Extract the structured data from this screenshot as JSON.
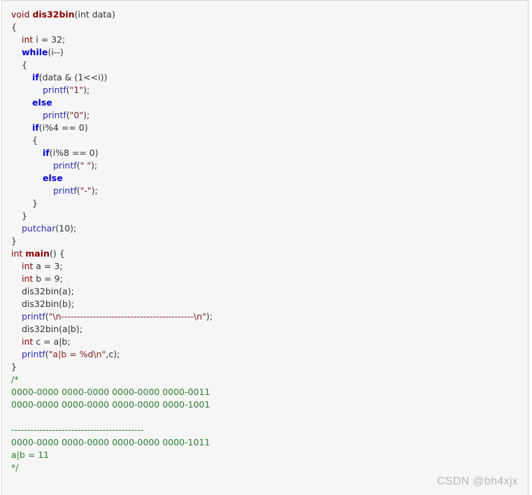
{
  "code": {
    "lines": [
      {
        "indent": 0,
        "parts": [
          {
            "t": "void ",
            "c": "kw-type"
          },
          {
            "t": "dis32bin",
            "c": "fn-def"
          },
          {
            "t": "(int data)",
            "c": ""
          }
        ]
      },
      {
        "indent": 0,
        "parts": [
          {
            "t": "{",
            "c": ""
          }
        ]
      },
      {
        "indent": 1,
        "parts": [
          {
            "t": "int",
            "c": "kw-type"
          },
          {
            "t": " i = 32;",
            "c": ""
          }
        ]
      },
      {
        "indent": 1,
        "parts": [
          {
            "t": "while",
            "c": "kw-ctrl"
          },
          {
            "t": "(i--)",
            "c": ""
          }
        ]
      },
      {
        "indent": 1,
        "parts": [
          {
            "t": "{",
            "c": ""
          }
        ]
      },
      {
        "indent": 2,
        "parts": [
          {
            "t": "if",
            "c": "kw-ctrl"
          },
          {
            "t": "(data & (1<<i))",
            "c": ""
          }
        ]
      },
      {
        "indent": 3,
        "parts": [
          {
            "t": "printf",
            "c": "fn-call"
          },
          {
            "t": "(",
            "c": ""
          },
          {
            "t": "\"1\"",
            "c": "str"
          },
          {
            "t": ");",
            "c": ""
          }
        ]
      },
      {
        "indent": 2,
        "parts": [
          {
            "t": "else",
            "c": "kw-ctrl"
          }
        ]
      },
      {
        "indent": 3,
        "parts": [
          {
            "t": "printf",
            "c": "fn-call"
          },
          {
            "t": "(",
            "c": ""
          },
          {
            "t": "\"0\"",
            "c": "str"
          },
          {
            "t": ");",
            "c": ""
          }
        ]
      },
      {
        "indent": 2,
        "parts": [
          {
            "t": "if",
            "c": "kw-ctrl"
          },
          {
            "t": "(i%4 == 0)",
            "c": ""
          }
        ]
      },
      {
        "indent": 2,
        "parts": [
          {
            "t": "{",
            "c": ""
          }
        ]
      },
      {
        "indent": 3,
        "parts": [
          {
            "t": "if",
            "c": "kw-ctrl"
          },
          {
            "t": "(i%8 == 0)",
            "c": ""
          }
        ]
      },
      {
        "indent": 4,
        "parts": [
          {
            "t": "printf",
            "c": "fn-call"
          },
          {
            "t": "(",
            "c": ""
          },
          {
            "t": "\" \"",
            "c": "str"
          },
          {
            "t": ");",
            "c": ""
          }
        ]
      },
      {
        "indent": 3,
        "parts": [
          {
            "t": "else",
            "c": "kw-ctrl"
          }
        ]
      },
      {
        "indent": 4,
        "parts": [
          {
            "t": "printf",
            "c": "fn-call"
          },
          {
            "t": "(",
            "c": ""
          },
          {
            "t": "\"-\"",
            "c": "str"
          },
          {
            "t": ");",
            "c": ""
          }
        ]
      },
      {
        "indent": 2,
        "parts": [
          {
            "t": "}",
            "c": ""
          }
        ]
      },
      {
        "indent": 1,
        "parts": [
          {
            "t": "}",
            "c": ""
          }
        ]
      },
      {
        "indent": 1,
        "parts": [
          {
            "t": "putchar",
            "c": "fn-call"
          },
          {
            "t": "(10);",
            "c": ""
          }
        ]
      },
      {
        "indent": 0,
        "parts": [
          {
            "t": "}",
            "c": ""
          }
        ]
      },
      {
        "indent": 0,
        "parts": [
          {
            "t": "int ",
            "c": "kw-type"
          },
          {
            "t": "main",
            "c": "fn-def"
          },
          {
            "t": "() {",
            "c": ""
          }
        ]
      },
      {
        "indent": 1,
        "parts": [
          {
            "t": "int",
            "c": "kw-type"
          },
          {
            "t": " a = 3;",
            "c": ""
          }
        ]
      },
      {
        "indent": 1,
        "parts": [
          {
            "t": "int",
            "c": "kw-type"
          },
          {
            "t": " b = 9;",
            "c": ""
          }
        ]
      },
      {
        "indent": 1,
        "parts": [
          {
            "t": "dis32bin(a);",
            "c": ""
          }
        ]
      },
      {
        "indent": 1,
        "parts": [
          {
            "t": "dis32bin(b);",
            "c": ""
          }
        ]
      },
      {
        "indent": 1,
        "parts": [
          {
            "t": "printf",
            "c": "fn-call"
          },
          {
            "t": "(",
            "c": ""
          },
          {
            "t": "\"\\n------------------------------------------\\n\"",
            "c": "str"
          },
          {
            "t": ");",
            "c": ""
          }
        ]
      },
      {
        "indent": 1,
        "parts": [
          {
            "t": "dis32bin(a|b);",
            "c": ""
          }
        ]
      },
      {
        "indent": 1,
        "parts": [
          {
            "t": "int",
            "c": "kw-type"
          },
          {
            "t": " c = a|b;",
            "c": ""
          }
        ]
      },
      {
        "indent": 1,
        "parts": [
          {
            "t": "printf",
            "c": "fn-call"
          },
          {
            "t": "(",
            "c": ""
          },
          {
            "t": "\"a|b = %d\\n\"",
            "c": "str"
          },
          {
            "t": ",c);",
            "c": ""
          }
        ]
      },
      {
        "indent": 0,
        "parts": [
          {
            "t": "}",
            "c": ""
          }
        ]
      },
      {
        "indent": 0,
        "parts": [
          {
            "t": "/*",
            "c": "comment"
          }
        ]
      },
      {
        "indent": 0,
        "parts": [
          {
            "t": "0000-0000 0000-0000 0000-0000 0000-0011",
            "c": "comment"
          }
        ]
      },
      {
        "indent": 0,
        "parts": [
          {
            "t": "0000-0000 0000-0000 0000-0000 0000-1001",
            "c": "comment"
          }
        ]
      },
      {
        "indent": 0,
        "parts": [
          {
            "t": "",
            "c": "comment"
          }
        ]
      },
      {
        "indent": 0,
        "parts": [
          {
            "t": "------------------------------------------",
            "c": "comment"
          }
        ]
      },
      {
        "indent": 0,
        "parts": [
          {
            "t": "0000-0000 0000-0000 0000-0000 0000-1011",
            "c": "comment"
          }
        ]
      },
      {
        "indent": 0,
        "parts": [
          {
            "t": "a|b = 11",
            "c": "comment"
          }
        ]
      },
      {
        "indent": 0,
        "parts": [
          {
            "t": "*/",
            "c": "comment"
          }
        ]
      }
    ]
  },
  "watermark": "CSDN @bh4xjx"
}
